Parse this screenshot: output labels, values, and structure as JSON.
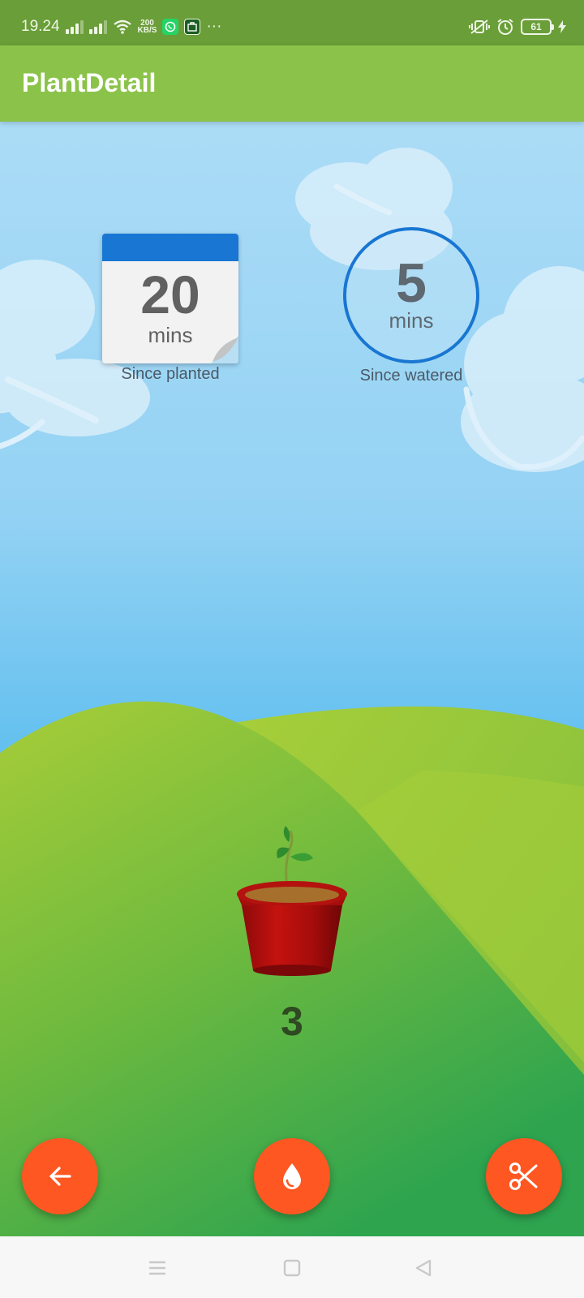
{
  "status_bar": {
    "time": "19.24",
    "net_speed_value": "200",
    "net_speed_unit": "KB/S",
    "more": "···",
    "battery_level": "61",
    "icons": [
      "signal-icon",
      "signal-icon",
      "wifi-icon",
      "whatsapp-icon",
      "app-notification-icon",
      "vibrate-icon",
      "alarm-icon",
      "battery-icon",
      "charging-icon"
    ]
  },
  "app_bar": {
    "title": "PlantDetail"
  },
  "planted": {
    "value": "20",
    "unit": "mins",
    "caption": "Since planted"
  },
  "watered": {
    "value": "5",
    "unit": "mins",
    "caption": "Since watered"
  },
  "plant": {
    "count": "3",
    "icon": "potted-plant-icon"
  },
  "actions": {
    "back_icon": "arrow-back-icon",
    "water_icon": "water-drop-icon",
    "harvest_icon": "scissors-icon",
    "accent_color": "#ff5722"
  },
  "colors": {
    "status_bar": "#6a9e38",
    "app_bar": "#8bc34a",
    "calendar_header": "#1976d2",
    "ring": "#1976d2"
  },
  "nav": {
    "icons": [
      "menu-icon",
      "home-square-icon",
      "back-triangle-icon"
    ]
  }
}
